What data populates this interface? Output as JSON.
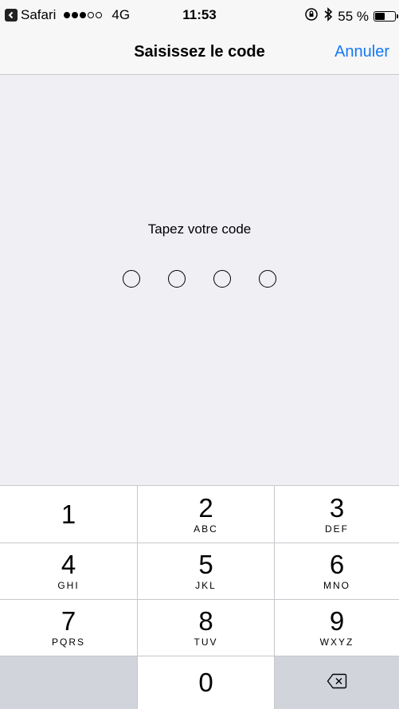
{
  "status_bar": {
    "back_app": "Safari",
    "signal_bars": 3,
    "signal_total": 5,
    "network": "4G",
    "time": "11:53",
    "battery_percent_text": "55 %",
    "battery_level": 0.55
  },
  "nav": {
    "title": "Saisissez le code",
    "cancel": "Annuler"
  },
  "passcode": {
    "prompt": "Tapez votre code",
    "length": 4,
    "entered": 0
  },
  "keypad": {
    "keys": [
      {
        "digit": "1",
        "letters": ""
      },
      {
        "digit": "2",
        "letters": "ABC"
      },
      {
        "digit": "3",
        "letters": "DEF"
      },
      {
        "digit": "4",
        "letters": "GHI"
      },
      {
        "digit": "5",
        "letters": "JKL"
      },
      {
        "digit": "6",
        "letters": "MNO"
      },
      {
        "digit": "7",
        "letters": "PQRS"
      },
      {
        "digit": "8",
        "letters": "TUV"
      },
      {
        "digit": "9",
        "letters": "WXYZ"
      },
      {
        "digit": "0",
        "letters": ""
      }
    ],
    "delete_icon": "backspace-icon"
  },
  "colors": {
    "accent": "#1479f5",
    "background": "#efeff4",
    "keypad_gray": "#d1d5db"
  }
}
